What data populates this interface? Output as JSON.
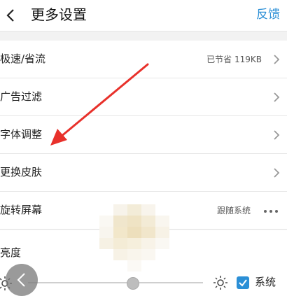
{
  "header": {
    "title": "更多设置",
    "feedback": "反馈"
  },
  "rows": [
    {
      "label": "极速/省流",
      "value": "已节省 119KB"
    },
    {
      "label": "广告过滤"
    },
    {
      "label": "字体调整"
    },
    {
      "label": "更换皮肤"
    },
    {
      "label": "旋转屏幕",
      "value": "跟随系统"
    }
  ],
  "brightness": {
    "label": "亮度",
    "level": 0.6,
    "system_label": "系统",
    "system_checked": true
  },
  "colors": {
    "accent": "#2b8fd6",
    "annotation_arrow": "#e8312b"
  }
}
